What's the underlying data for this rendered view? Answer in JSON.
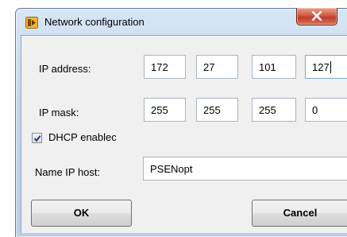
{
  "window": {
    "title": "Network configuration",
    "close_glyph": "X"
  },
  "form": {
    "ip_address_label": "IP address:",
    "ip_address": [
      "172",
      "27",
      "101",
      "127"
    ],
    "ip_mask_label": "IP mask:",
    "ip_mask": [
      "255",
      "255",
      "255",
      "0"
    ],
    "dhcp_label": "DHCP enablec",
    "dhcp_checked": true,
    "host_label": "Name IP host:",
    "host_value": "PSENopt"
  },
  "buttons": {
    "ok_label": "OK",
    "cancel_label": "Cancel"
  },
  "colors": {
    "titlebar": "#c3d7ec",
    "close_button": "#c0392b",
    "client_background": "#f0f0f0"
  }
}
